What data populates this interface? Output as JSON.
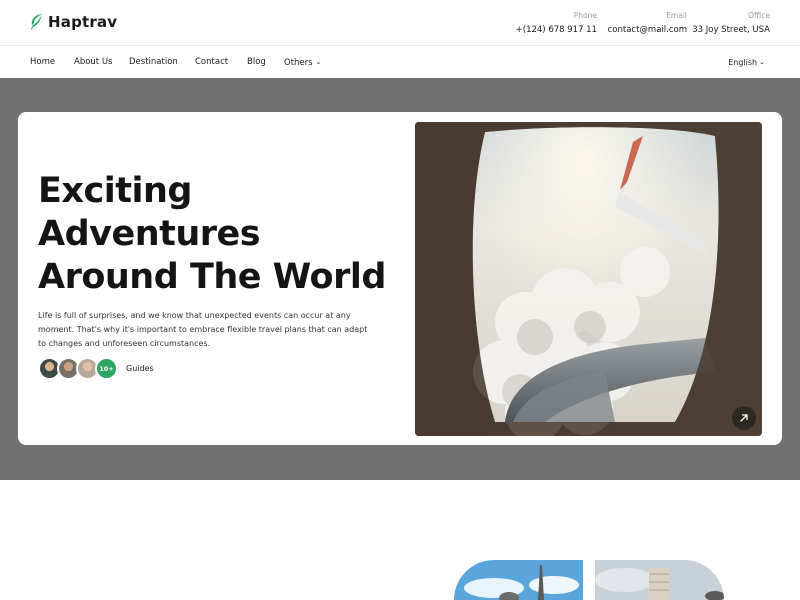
{
  "brand": {
    "name": "Haptrav",
    "accent": "#2da562"
  },
  "contacts": {
    "phone": {
      "label": "Phone",
      "value": "+(124) 678 917 11"
    },
    "email": {
      "label": "Email",
      "value": "contact@mail.com"
    },
    "office": {
      "label": "Office",
      "value": "33 Joy Street, USA"
    }
  },
  "nav": {
    "items": [
      {
        "label": "Home"
      },
      {
        "label": "About Us"
      },
      {
        "label": "Destination"
      },
      {
        "label": "Contact"
      },
      {
        "label": "Blog"
      },
      {
        "label": "Others",
        "dropdown": true
      }
    ],
    "language": "English"
  },
  "hero": {
    "title_lines": [
      "Exciting",
      "Adventures",
      "Around The World"
    ],
    "description": "Life is full of surprises, and we know that unexpected events can occur at any moment. That's why it's important to embrace flexible travel plans that can adapt to changes and unforeseen circumstances.",
    "guides_count": "10+",
    "guides_label": "Guides",
    "photo_icon": "airplane-window-photo",
    "arrow_icon": "arrow-up-right-icon"
  },
  "colors": {
    "hero_backdrop": "#717171",
    "text_dark": "#141414"
  }
}
